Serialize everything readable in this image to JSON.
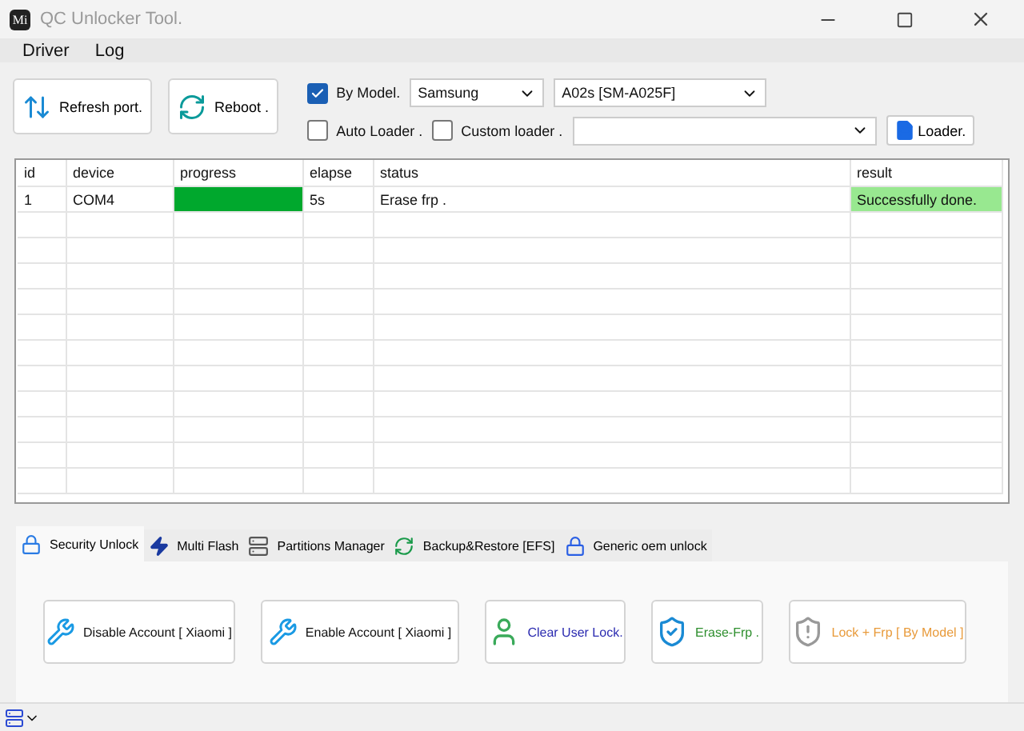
{
  "window": {
    "title": "QC Unlocker Tool.",
    "logo": "Mi"
  },
  "menu": [
    "Driver",
    "Log"
  ],
  "toolbar": {
    "buttons": [
      {
        "label": "Refresh port.",
        "kind": "refresh"
      },
      {
        "label": "Reboot .",
        "kind": "reboot"
      }
    ],
    "by_model": {
      "label": "By  Model.",
      "checked": true
    },
    "brand": {
      "value": "Samsung"
    },
    "model": {
      "value": "A02s [SM-A025F]"
    },
    "auto_loader": {
      "label": "Auto Loader .",
      "checked": false
    },
    "custom_loader": {
      "label": "Custom loader .",
      "checked": false
    },
    "loader_button": {
      "label": "Loader."
    }
  },
  "table": {
    "columns": [
      "id",
      "device",
      "progress",
      "elapse",
      "status",
      "result"
    ],
    "rows": [
      {
        "id": "1",
        "device": "COM4",
        "level": 1,
        "elapse": "5s",
        "status": "Erase frp .",
        "result": "Successfully done."
      }
    ]
  },
  "tabs": [
    {
      "label": "Security Unlock",
      "kind": "lock",
      "selected": true
    },
    {
      "label": "Multi Flash",
      "kind": "flash",
      "selected": false
    },
    {
      "label": "Partitions Manager",
      "kind": "partitions",
      "selected": false
    },
    {
      "label": "Backup&Restore [EFS]",
      "kind": "backup",
      "selected": false
    },
    {
      "label": "Generic oem unlock",
      "kind": "oem",
      "selected": false
    }
  ],
  "actions": [
    {
      "label": "Disable Account [ Xiaomi ]",
      "kind": "tools",
      "color": "#111111"
    },
    {
      "label": "Enable Account [ Xiaomi ]",
      "kind": "tools",
      "color": "#111111"
    },
    {
      "label": "Clear User Lock.",
      "kind": "user",
      "color": "#2a2ab0"
    },
    {
      "label": "Erase-Frp .",
      "kind": "shield",
      "color": "#2f8f2f"
    },
    {
      "label": "Lock + Frp [ By Model ]",
      "kind": "warning",
      "color": "#e89a3a"
    }
  ]
}
